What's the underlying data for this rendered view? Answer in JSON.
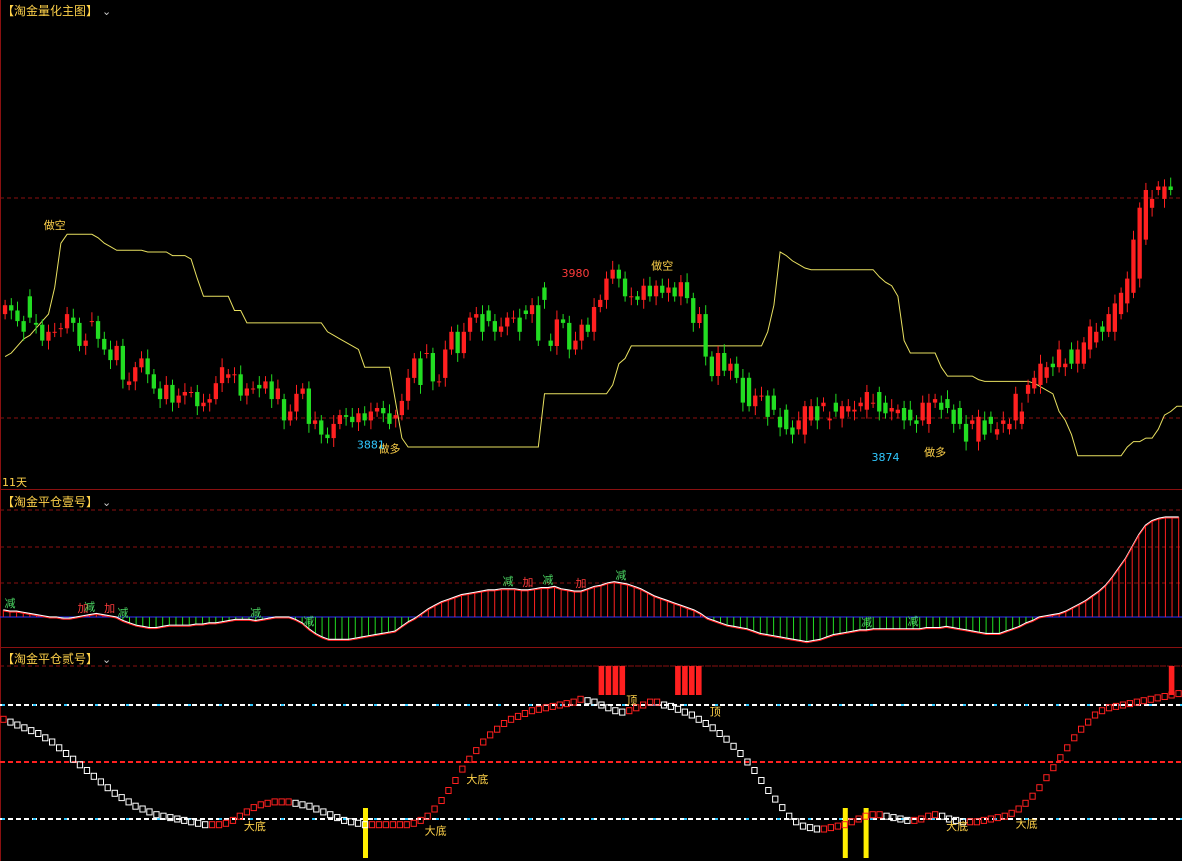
{
  "main": {
    "title": "【淘金量化主图】",
    "chevron": "⌄",
    "day_label": "11天",
    "candles_open": [
      3950,
      3955,
      3952,
      3946,
      3960,
      3945,
      3944,
      3935,
      3940,
      3942,
      3942,
      3948,
      3945,
      3932,
      3946,
      3946,
      3936,
      3930,
      3924,
      3932,
      3910,
      3912,
      3920,
      3925,
      3916,
      3908,
      3902,
      3910,
      3900,
      3904,
      3906,
      3906,
      3898,
      3900,
      3902,
      3911,
      3914,
      3916,
      3916,
      3904,
      3908,
      3910,
      3908,
      3912,
      3902,
      3902,
      3890,
      3895,
      3905,
      3908,
      3888,
      3890,
      3882,
      3880,
      3888,
      3893,
      3892,
      3889,
      3894,
      3890,
      3895,
      3897,
      3894,
      3891,
      3893,
      3901,
      3914,
      3925,
      3928,
      3928,
      3912,
      3914,
      3930,
      3940,
      3928,
      3940,
      3948,
      3950,
      3952,
      3946,
      3940,
      3943,
      3948,
      3948,
      3952,
      3950,
      3955,
      3965,
      3935,
      3932,
      3947,
      3945,
      3930,
      3935,
      3944,
      3940,
      3954,
      3958,
      3970,
      3975,
      3970,
      3960,
      3960,
      3958,
      3966,
      3960,
      3966,
      3962,
      3965,
      3960,
      3968,
      3959,
      3945,
      3950,
      3926,
      3915,
      3928,
      3918,
      3922,
      3914,
      3914,
      3898,
      3904,
      3904,
      3904,
      3892,
      3896,
      3886,
      3885,
      3882,
      3890,
      3898,
      3898,
      3890,
      3900,
      3891,
      3895,
      3895,
      3898,
      3896,
      3900,
      3906,
      3900,
      3895,
      3894,
      3897,
      3896,
      3890,
      3890,
      3888,
      3900,
      3900,
      3902,
      3896,
      3897,
      3888,
      3888,
      3878,
      3890,
      3892,
      3882,
      3888,
      3885,
      3890,
      3888,
      3905,
      3908,
      3910,
      3914,
      3922,
      3920,
      3920,
      3930,
      3922,
      3922,
      3930,
      3934,
      3943,
      3940,
      3940,
      3950,
      3956,
      3962,
      3970,
      3992,
      4010,
      4020,
      4015,
      4022,
      4022
    ],
    "candles_close": [
      3955,
      3952,
      3946,
      3940,
      3948,
      3944,
      3935,
      3940,
      3940,
      3942,
      3950,
      3945,
      3932,
      3935,
      3946,
      3936,
      3930,
      3924,
      3932,
      3913,
      3912,
      3920,
      3925,
      3916,
      3908,
      3902,
      3910,
      3900,
      3904,
      3906,
      3906,
      3898,
      3900,
      3902,
      3911,
      3920,
      3916,
      3916,
      3904,
      3908,
      3908,
      3908,
      3912,
      3902,
      3908,
      3890,
      3895,
      3905,
      3908,
      3888,
      3890,
      3882,
      3880,
      3888,
      3893,
      3892,
      3889,
      3894,
      3890,
      3895,
      3897,
      3894,
      3888,
      3893,
      3901,
      3914,
      3925,
      3910,
      3928,
      3912,
      3912,
      3930,
      3940,
      3928,
      3940,
      3948,
      3950,
      3940,
      3946,
      3940,
      3943,
      3948,
      3948,
      3940,
      3950,
      3955,
      3935,
      3958,
      3932,
      3947,
      3945,
      3930,
      3935,
      3944,
      3940,
      3954,
      3958,
      3970,
      3975,
      3970,
      3960,
      3960,
      3958,
      3966,
      3960,
      3966,
      3962,
      3965,
      3960,
      3968,
      3959,
      3945,
      3950,
      3926,
      3915,
      3928,
      3918,
      3922,
      3914,
      3900,
      3898,
      3904,
      3904,
      3892,
      3896,
      3886,
      3885,
      3882,
      3890,
      3898,
      3898,
      3890,
      3900,
      3891,
      3895,
      3898,
      3898,
      3896,
      3900,
      3906,
      3900,
      3895,
      3894,
      3897,
      3896,
      3890,
      3890,
      3888,
      3900,
      3900,
      3902,
      3896,
      3897,
      3888,
      3888,
      3878,
      3890,
      3892,
      3882,
      3888,
      3885,
      3890,
      3888,
      3905,
      3895,
      3910,
      3914,
      3922,
      3920,
      3920,
      3930,
      3922,
      3922,
      3930,
      3934,
      3943,
      3940,
      3940,
      3950,
      3956,
      3962,
      3970,
      3992,
      4010,
      4020,
      4015,
      4022,
      4022,
      4020
    ],
    "band_y": [
      3926,
      3928,
      3932,
      3936,
      3938,
      3942,
      3946,
      3950,
      3965,
      3990,
      3995,
      3995,
      3995,
      3995,
      3995,
      3993,
      3990,
      3988,
      3986,
      3986,
      3986,
      3986,
      3986,
      3985,
      3985,
      3985,
      3985,
      3983,
      3983,
      3983,
      3981,
      3970,
      3960,
      3960,
      3960,
      3960,
      3960,
      3952,
      3952,
      3945,
      3945,
      3945,
      3945,
      3945,
      3945,
      3945,
      3945,
      3945,
      3945,
      3945,
      3945,
      3945,
      3940,
      3938,
      3936,
      3934,
      3932,
      3930,
      3920,
      3920,
      3920,
      3920,
      3920,
      3900,
      3880,
      3875,
      3875,
      3875,
      3875,
      3875,
      3875,
      3875,
      3875,
      3875,
      3875,
      3875,
      3875,
      3875,
      3875,
      3875,
      3875,
      3875,
      3875,
      3875,
      3875,
      3875,
      3875,
      3905,
      3905,
      3905,
      3905,
      3905,
      3905,
      3905,
      3905,
      3905,
      3905,
      3905,
      3910,
      3922,
      3925,
      3932,
      3932,
      3932,
      3932,
      3932,
      3932,
      3932,
      3932,
      3932,
      3932,
      3932,
      3932,
      3932,
      3932,
      3932,
      3932,
      3932,
      3932,
      3932,
      3932,
      3932,
      3932,
      3940,
      3955,
      3985,
      3983,
      3980,
      3978,
      3976,
      3975,
      3975,
      3975,
      3975,
      3975,
      3975,
      3975,
      3975,
      3975,
      3975,
      3975,
      3971,
      3968,
      3966,
      3960,
      3935,
      3928,
      3928,
      3928,
      3928,
      3928,
      3920,
      3915,
      3915,
      3915,
      3915,
      3915,
      3913,
      3912,
      3912,
      3912,
      3912,
      3912,
      3912,
      3912,
      3912,
      3911,
      3909,
      3907,
      3905,
      3895,
      3890,
      3882,
      3870,
      3870,
      3870,
      3870,
      3870,
      3870,
      3870,
      3870,
      3875,
      3878,
      3878,
      3880,
      3880,
      3885,
      3893,
      3895,
      3898,
      3898,
      3898,
      3898,
      3898,
      3898,
      3908,
      3910,
      3910,
      3911
    ],
    "markers": [
      {
        "text": "做空",
        "i": 8,
        "v": 3998,
        "color": "#ffd24a"
      },
      {
        "text": "做多",
        "i": 62,
        "v": 3872,
        "color": "#ffd24a"
      },
      {
        "text": "3881",
        "i": 59,
        "v": 3874,
        "color": "#30c8ff"
      },
      {
        "text": "3980",
        "i": 92,
        "v": 3971,
        "color": "#ff3c3c"
      },
      {
        "text": "做空",
        "i": 106,
        "v": 3975,
        "color": "#ffd24a"
      },
      {
        "text": "3874",
        "i": 142,
        "v": 3867,
        "color": "#30c8ff"
      },
      {
        "text": "做多",
        "i": 150,
        "v": 3870,
        "color": "#ffd24a"
      }
    ],
    "ylim": [
      3862,
      4020
    ]
  },
  "osc1": {
    "title": "【淘金平仓壹号】",
    "chevron": "⌄",
    "values": [
      6,
      5,
      5,
      4,
      3,
      2,
      1,
      0,
      0,
      -1,
      -1,
      0,
      1,
      2,
      3,
      2,
      1,
      0,
      -3,
      -5,
      -7,
      -8,
      -9,
      -9,
      -8,
      -7,
      -7,
      -7,
      -7,
      -6,
      -6,
      -5,
      -5,
      -4,
      -3,
      -2,
      -2,
      -2,
      -3,
      -2,
      -1,
      0,
      0,
      0,
      -2,
      -5,
      -10,
      -14,
      -17,
      -19,
      -19,
      -19,
      -19,
      -18,
      -17,
      -16,
      -15,
      -14,
      -13,
      -12,
      -8,
      -4,
      -1,
      3,
      7,
      10,
      13,
      15,
      17,
      19,
      20,
      21,
      22,
      23,
      23,
      24,
      24,
      24,
      23,
      23,
      24,
      25,
      25,
      26,
      24,
      23,
      22,
      22,
      24,
      26,
      27,
      29,
      30,
      29,
      28,
      26,
      24,
      21,
      18,
      16,
      14,
      12,
      10,
      8,
      6,
      3,
      -1,
      -3,
      -5,
      -7,
      -8,
      -9,
      -10,
      -12,
      -14,
      -15,
      -16,
      -17,
      -18,
      -19,
      -20,
      -21,
      -20,
      -19,
      -17,
      -15,
      -14,
      -13,
      -12,
      -11,
      -11,
      -10,
      -10,
      -10,
      -10,
      -10,
      -10,
      -10,
      -10,
      -9,
      -9,
      -9,
      -8,
      -9,
      -10,
      -11,
      -12,
      -13,
      -14,
      -14,
      -14,
      -12,
      -10,
      -8,
      -5,
      -3,
      0,
      1,
      2,
      3,
      5,
      8,
      11,
      14,
      18,
      22,
      27,
      34,
      42,
      50,
      60,
      70,
      78,
      82,
      84,
      85,
      85,
      85
    ],
    "markers": [
      {
        "text": "减",
        "i": 1,
        "color": "#4cd964"
      },
      {
        "text": "加",
        "i": 12,
        "color": "#ff3c3c"
      },
      {
        "text": "减",
        "i": 13,
        "color": "#4cd964"
      },
      {
        "text": "加",
        "i": 16,
        "color": "#ff3c3c"
      },
      {
        "text": "减",
        "i": 18,
        "color": "#4cd964"
      },
      {
        "text": "减",
        "i": 38,
        "color": "#4cd964"
      },
      {
        "text": "减",
        "i": 46,
        "color": "#4cd964"
      },
      {
        "text": "减",
        "i": 76,
        "color": "#4cd964"
      },
      {
        "text": "加",
        "i": 79,
        "color": "#ff3c3c"
      },
      {
        "text": "减",
        "i": 82,
        "color": "#4cd964"
      },
      {
        "text": "加",
        "i": 87,
        "color": "#ff3c3c"
      },
      {
        "text": "减",
        "i": 93,
        "color": "#4cd964"
      },
      {
        "text": "减",
        "i": 130,
        "color": "#4cd964"
      },
      {
        "text": "减",
        "i": 137,
        "color": "#4cd964"
      }
    ]
  },
  "osc2": {
    "title": "【淘金平仓贰号】",
    "chevron": "⌄",
    "values": [
      80,
      78,
      76,
      74,
      72,
      70,
      67,
      64,
      60,
      56,
      52,
      48,
      44,
      40,
      36,
      32,
      28,
      25,
      22,
      19,
      17,
      15,
      13,
      12,
      11,
      10,
      9,
      8,
      7,
      6,
      6,
      6,
      7,
      9,
      12,
      15,
      18,
      20,
      21,
      22,
      22,
      22,
      21,
      20,
      19,
      17,
      15,
      13,
      11,
      9,
      8,
      7,
      6,
      6,
      6,
      6,
      6,
      6,
      6,
      7,
      9,
      12,
      17,
      23,
      30,
      37,
      45,
      52,
      58,
      64,
      69,
      73,
      77,
      80,
      82,
      84,
      86,
      87,
      88,
      89,
      90,
      91,
      92,
      94,
      93,
      92,
      90,
      88,
      86,
      85,
      86,
      88,
      90,
      92,
      92,
      90,
      89,
      87,
      85,
      83,
      80,
      77,
      74,
      70,
      66,
      61,
      56,
      50,
      44,
      37,
      30,
      24,
      18,
      12,
      8,
      5,
      4,
      3,
      3,
      4,
      5,
      6,
      8,
      10,
      12,
      13,
      13,
      12,
      11,
      10,
      9,
      9,
      10,
      12,
      13,
      12,
      10,
      9,
      8,
      8,
      8,
      9,
      10,
      11,
      12,
      14,
      17,
      21,
      26,
      32,
      39,
      46,
      53,
      60,
      67,
      73,
      78,
      83,
      86,
      88,
      89,
      90,
      91,
      92,
      93,
      94,
      95,
      96,
      97,
      98
    ],
    "markers": [
      {
        "text": "大底",
        "i": 34,
        "color": "#ffd24a"
      },
      {
        "text": "大底",
        "i": 60,
        "color": "#ffd24a"
      },
      {
        "text": "大底",
        "i": 66,
        "color": "#ffd24a"
      },
      {
        "text": "顶",
        "i": 89,
        "color": "#ffd24a"
      },
      {
        "text": "顶",
        "i": 101,
        "color": "#ffd24a"
      },
      {
        "text": "大底",
        "i": 135,
        "color": "#ffd24a"
      },
      {
        "text": "大底",
        "i": 145,
        "color": "#ffd24a"
      }
    ],
    "top_bars": [
      86,
      87,
      88,
      89,
      97,
      98,
      99,
      100,
      168,
      171,
      172,
      173,
      174,
      175,
      176,
      177,
      178,
      179,
      180,
      181
    ],
    "bottom_bars": [
      52,
      121,
      124
    ],
    "levels": [
      {
        "v": 90,
        "color": "#ffffff",
        "alt": "#30c8ff"
      },
      {
        "v": 50,
        "color": "#ff2020",
        "alt": "#ff2020"
      },
      {
        "v": 10,
        "color": "#ffffff",
        "alt": "#30c8ff"
      }
    ]
  },
  "colors": {
    "up": "#ff2020",
    "down": "#22dd22",
    "band": "#e8e060",
    "grid": "#8a1010",
    "axis": "#3030ff"
  }
}
